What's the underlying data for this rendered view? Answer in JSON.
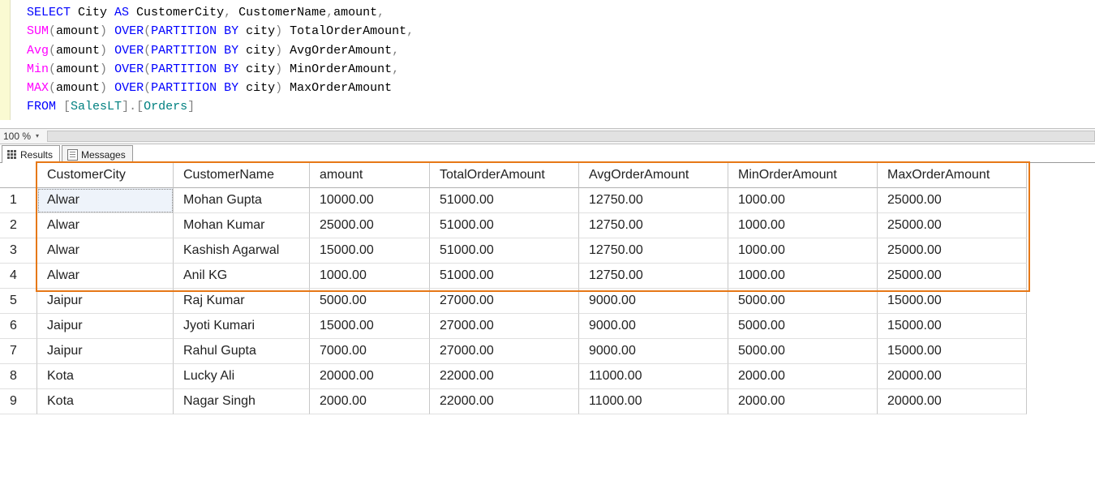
{
  "sql": {
    "line1": {
      "select": "SELECT",
      "expr1": " City ",
      "as": "AS",
      "expr2": " CustomerCity",
      "comma1": ",",
      "expr3": " CustomerName",
      "comma2": ",",
      "expr4": "amount",
      "comma3": ","
    },
    "agg_lines": [
      {
        "fn": "SUM",
        "open": "(",
        "arg": "amount",
        "close": ")",
        "over": " OVER",
        "open2": "(",
        "part": "PARTITION",
        "by": " BY",
        "col": " city",
        "close2": ")",
        "alias": " TotalOrderAmount",
        "comma": ","
      },
      {
        "fn": "Avg",
        "open": "(",
        "arg": "amount",
        "close": ")",
        "over": " OVER",
        "open2": "(",
        "part": "PARTITION",
        "by": " BY",
        "col": " city",
        "close2": ")",
        "alias": " AvgOrderAmount",
        "comma": ","
      },
      {
        "fn": "Min",
        "open": "(",
        "arg": "amount",
        "close": ")",
        "over": " OVER",
        "open2": "(",
        "part": "PARTITION",
        "by": " BY",
        "col": " city",
        "close2": ")",
        "alias": " MinOrderAmount",
        "comma": ","
      },
      {
        "fn": "MAX",
        "open": "(",
        "arg": "amount",
        "close": ")",
        "over": " OVER",
        "open2": "(",
        "part": "PARTITION",
        "by": " BY",
        "col": " city",
        "close2": ")",
        "alias": " MaxOrderAmount",
        "comma": ""
      }
    ],
    "from": {
      "kw": "FROM",
      "space": " ",
      "open1": "[",
      "schema": "SalesLT",
      "close1": "]",
      "dot": ".",
      "open2": "[",
      "table": "Orders",
      "close2": "]"
    }
  },
  "zoom": {
    "label": "100 %"
  },
  "tabs": {
    "results": "Results",
    "messages": "Messages"
  },
  "columns": [
    "CustomerCity",
    "CustomerName",
    "amount",
    "TotalOrderAmount",
    "AvgOrderAmount",
    "MinOrderAmount",
    "MaxOrderAmount"
  ],
  "rows": [
    {
      "n": "1",
      "CustomerCity": "Alwar",
      "CustomerName": "Mohan Gupta",
      "amount": "10000.00",
      "TotalOrderAmount": "51000.00",
      "AvgOrderAmount": "12750.00",
      "MinOrderAmount": "1000.00",
      "MaxOrderAmount": "25000.00"
    },
    {
      "n": "2",
      "CustomerCity": "Alwar",
      "CustomerName": "Mohan Kumar",
      "amount": "25000.00",
      "TotalOrderAmount": "51000.00",
      "AvgOrderAmount": "12750.00",
      "MinOrderAmount": "1000.00",
      "MaxOrderAmount": "25000.00"
    },
    {
      "n": "3",
      "CustomerCity": "Alwar",
      "CustomerName": "Kashish Agarwal",
      "amount": "15000.00",
      "TotalOrderAmount": "51000.00",
      "AvgOrderAmount": "12750.00",
      "MinOrderAmount": "1000.00",
      "MaxOrderAmount": "25000.00"
    },
    {
      "n": "4",
      "CustomerCity": "Alwar",
      "CustomerName": "Anil KG",
      "amount": "1000.00",
      "TotalOrderAmount": "51000.00",
      "AvgOrderAmount": "12750.00",
      "MinOrderAmount": "1000.00",
      "MaxOrderAmount": "25000.00"
    },
    {
      "n": "5",
      "CustomerCity": "Jaipur",
      "CustomerName": "Raj Kumar",
      "amount": "5000.00",
      "TotalOrderAmount": "27000.00",
      "AvgOrderAmount": "9000.00",
      "MinOrderAmount": "5000.00",
      "MaxOrderAmount": "15000.00"
    },
    {
      "n": "6",
      "CustomerCity": "Jaipur",
      "CustomerName": "Jyoti Kumari",
      "amount": "15000.00",
      "TotalOrderAmount": "27000.00",
      "AvgOrderAmount": "9000.00",
      "MinOrderAmount": "5000.00",
      "MaxOrderAmount": "15000.00"
    },
    {
      "n": "7",
      "CustomerCity": "Jaipur",
      "CustomerName": "Rahul Gupta",
      "amount": "7000.00",
      "TotalOrderAmount": "27000.00",
      "AvgOrderAmount": "9000.00",
      "MinOrderAmount": "5000.00",
      "MaxOrderAmount": "15000.00"
    },
    {
      "n": "8",
      "CustomerCity": "Kota",
      "CustomerName": "Lucky Ali",
      "amount": "20000.00",
      "TotalOrderAmount": "22000.00",
      "AvgOrderAmount": "11000.00",
      "MinOrderAmount": "2000.00",
      "MaxOrderAmount": "20000.00"
    },
    {
      "n": "9",
      "CustomerCity": "Kota",
      "CustomerName": "Nagar Singh",
      "amount": "2000.00",
      "TotalOrderAmount": "22000.00",
      "AvgOrderAmount": "11000.00",
      "MinOrderAmount": "2000.00",
      "MaxOrderAmount": "20000.00"
    }
  ],
  "highlight": {
    "from_row": 0,
    "to_row": 3
  },
  "colors": {
    "orange": "#e67817"
  }
}
